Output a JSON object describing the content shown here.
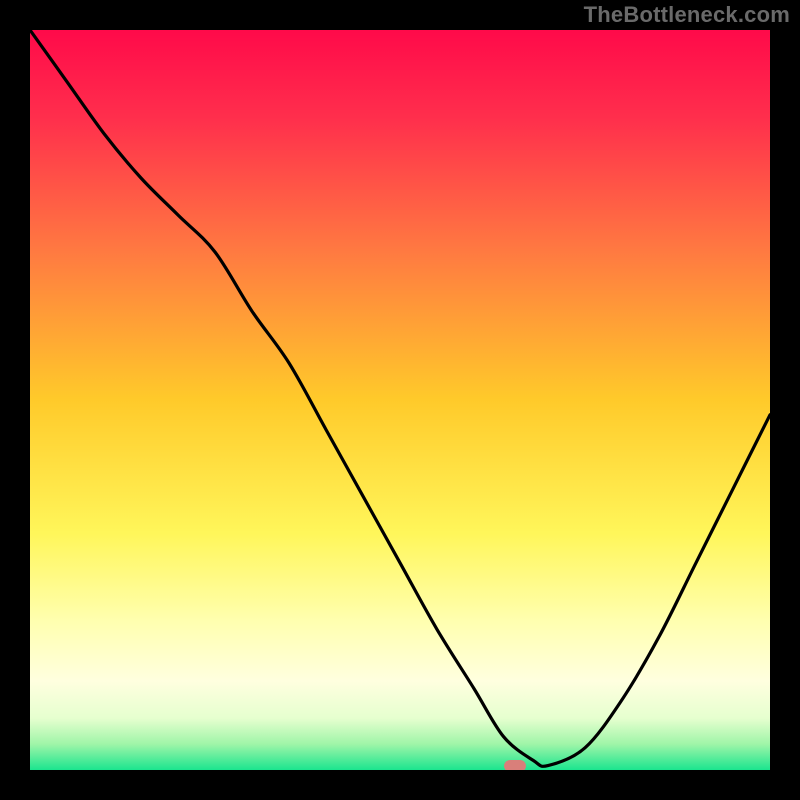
{
  "watermark": "TheBottleneck.com",
  "chart_data": {
    "type": "line",
    "title": "",
    "xlabel": "",
    "ylabel": "",
    "xlim": [
      0,
      100
    ],
    "ylim": [
      0,
      100
    ],
    "x": [
      0,
      5,
      10,
      15,
      20,
      25,
      30,
      35,
      40,
      45,
      50,
      55,
      60,
      64,
      68,
      70,
      75,
      80,
      85,
      90,
      95,
      100
    ],
    "values": [
      100,
      93,
      86,
      80,
      75,
      70,
      62,
      55,
      46,
      37,
      28,
      19,
      11,
      4.5,
      1.3,
      0.6,
      3.0,
      9.5,
      18,
      28,
      38,
      48
    ],
    "background": {
      "stops": [
        {
          "pos": 0.0,
          "color": "#ff0a4a"
        },
        {
          "pos": 0.12,
          "color": "#ff2f4c"
        },
        {
          "pos": 0.3,
          "color": "#ff7a41"
        },
        {
          "pos": 0.5,
          "color": "#ffca2a"
        },
        {
          "pos": 0.68,
          "color": "#fff65a"
        },
        {
          "pos": 0.8,
          "color": "#ffffb0"
        },
        {
          "pos": 0.88,
          "color": "#ffffdf"
        },
        {
          "pos": 0.93,
          "color": "#e6ffcf"
        },
        {
          "pos": 0.965,
          "color": "#9ff5a8"
        },
        {
          "pos": 1.0,
          "color": "#1be58f"
        }
      ]
    },
    "marker": {
      "x": 65.5,
      "y": 0.5,
      "color": "#d97f7a"
    },
    "line_color": "#000000",
    "line_width": 3.2
  }
}
